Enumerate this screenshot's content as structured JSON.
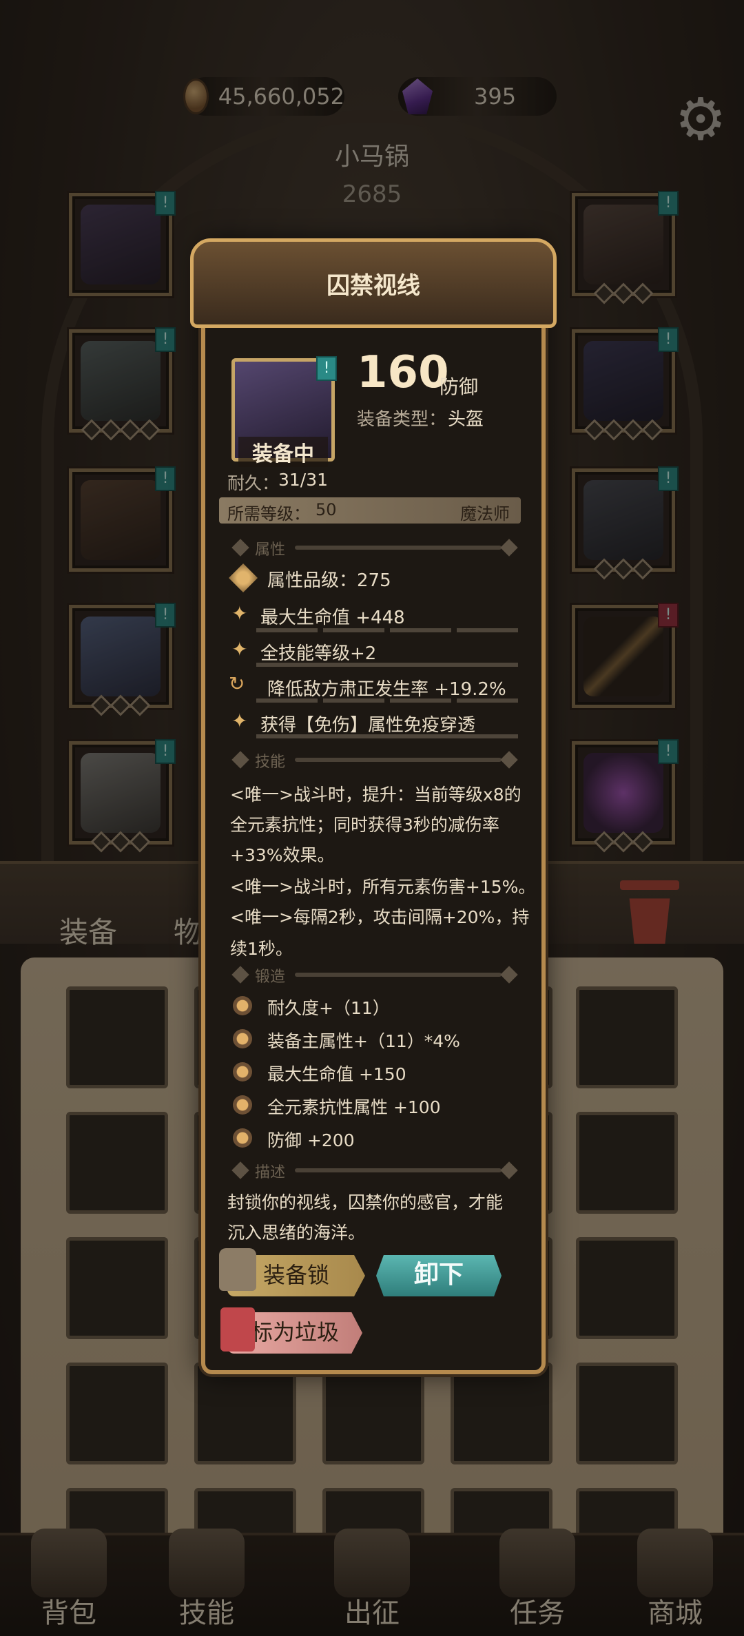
{
  "currency": {
    "gold": "45,660,052",
    "gems": "395"
  },
  "character": {
    "name": "小马锅",
    "power": "2685"
  },
  "inventory_tabs": {
    "equipment": "装备",
    "items": "物品"
  },
  "item": {
    "name": "囚禁视线",
    "status": "装备中",
    "stat_value": "160",
    "stat_unit": "防御",
    "type_label": "装备类型：",
    "type_value": "头盔",
    "durability_label": "耐久：",
    "durability_value": "31/31",
    "req_level_label": "所需等级：",
    "req_level_value": "50",
    "class": "魔法师",
    "sections": {
      "attributes": "属性",
      "skills": "技能",
      "forge": "锻造",
      "description": "描述"
    },
    "attr_grade": "属性品级：275",
    "attributes": [
      "最大生命值 +448",
      "全技能等级+2",
      "降低敌方肃正发生率 +19.2%",
      "获得【免伤】属性免疫穿透"
    ],
    "skill_lines": [
      "<唯一>战斗时，提升：当前等级x8的",
      "全元素抗性；同时获得3秒的减伤率",
      "+33%效果。",
      "<唯一>战斗时，所有元素伤害+15%。",
      "<唯一>每隔2秒，攻击间隔+20%，持",
      "续1秒。"
    ],
    "forge": [
      "耐久度+（11）",
      "装备主属性+（11）*4%",
      "最大生命值 +150",
      "全元素抗性属性 +100",
      "防御 +200"
    ],
    "description_lines": [
      "封锁你的视线，囚禁你的感官，才能",
      "沉入思绪的海洋。"
    ],
    "buttons": {
      "lock": "装备锁",
      "unequip": "卸下",
      "junk": "标为垃圾"
    }
  },
  "bottom_nav": [
    "背包",
    "技能",
    "出征",
    "任务",
    "商城"
  ],
  "colors": {
    "accent_gold": "#b58a4e",
    "teal": "#2f7e7b",
    "pink": "#e9a9a3"
  }
}
